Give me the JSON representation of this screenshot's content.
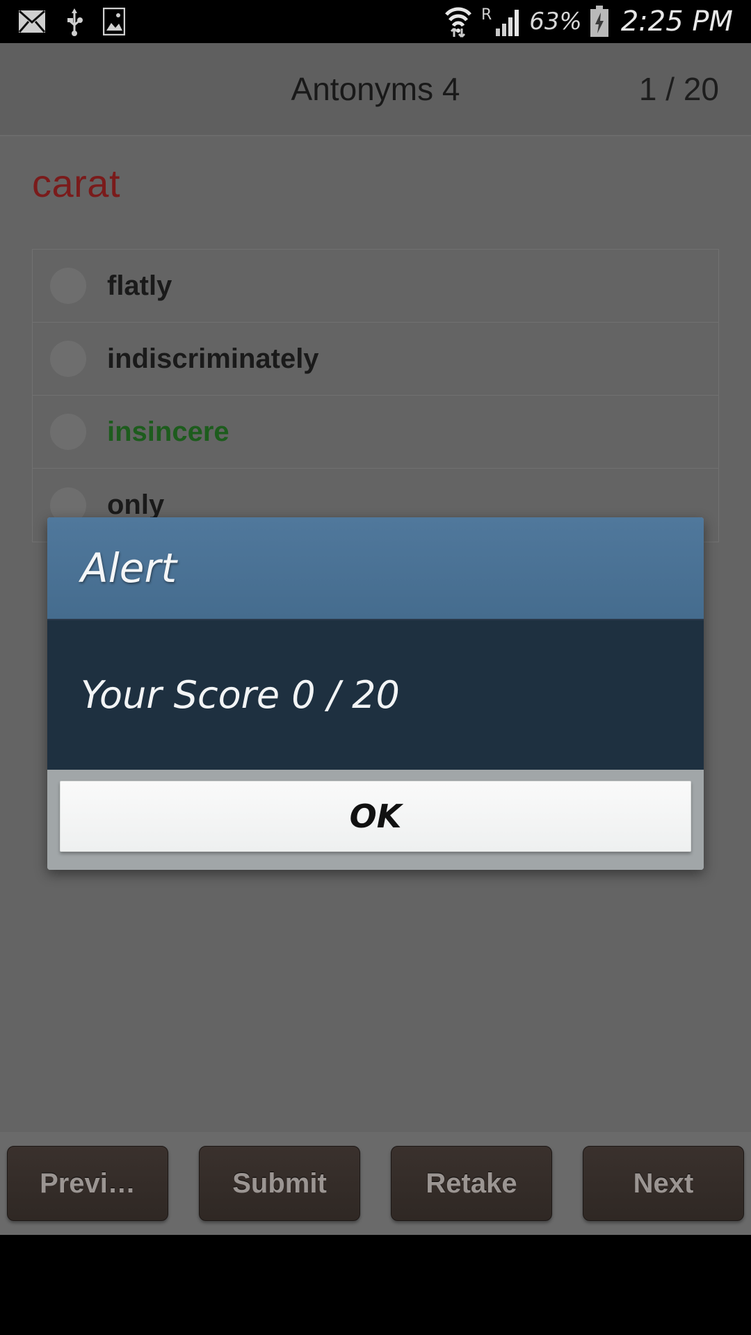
{
  "status_bar": {
    "left_icons": [
      {
        "name": "email-icon",
        "glyph": "✉"
      },
      {
        "name": "usb-icon",
        "glyph": "⚯"
      },
      {
        "name": "gallery-icon",
        "glyph": "Ὓc"
      }
    ],
    "wifi_icon": "wifi-data-transfer-icon",
    "roaming_label": "R",
    "signal_icon": "signal-bars-icon",
    "battery_percent": "63%",
    "battery_icon": "battery-charging-icon",
    "time": "2:25 PM"
  },
  "title_bar": {
    "title": "Antonyms 4",
    "progress": "1 / 20"
  },
  "quiz": {
    "question_word": "carat",
    "options": [
      {
        "label": "flatly",
        "correct": false
      },
      {
        "label": "indiscriminately",
        "correct": false
      },
      {
        "label": "insincere",
        "correct": true
      },
      {
        "label": "only",
        "correct": false
      }
    ]
  },
  "bottom_bar": {
    "previous_label": "Previ…",
    "submit_label": "Submit",
    "retake_label": "Retake",
    "next_label": "Next"
  },
  "alert_dialog": {
    "title": "Alert",
    "message": "Your Score 0 / 20",
    "ok_label": "OK"
  },
  "colors": {
    "dialog_header": "#4a7296",
    "dialog_body": "#1e3040",
    "dialog_footer": "#a1a6a8",
    "question_word": "#7a1b1b",
    "correct_option": "#1d5c1d",
    "nav_button": "#332b28",
    "app_background": "#646464",
    "status_bar": "#000000"
  }
}
